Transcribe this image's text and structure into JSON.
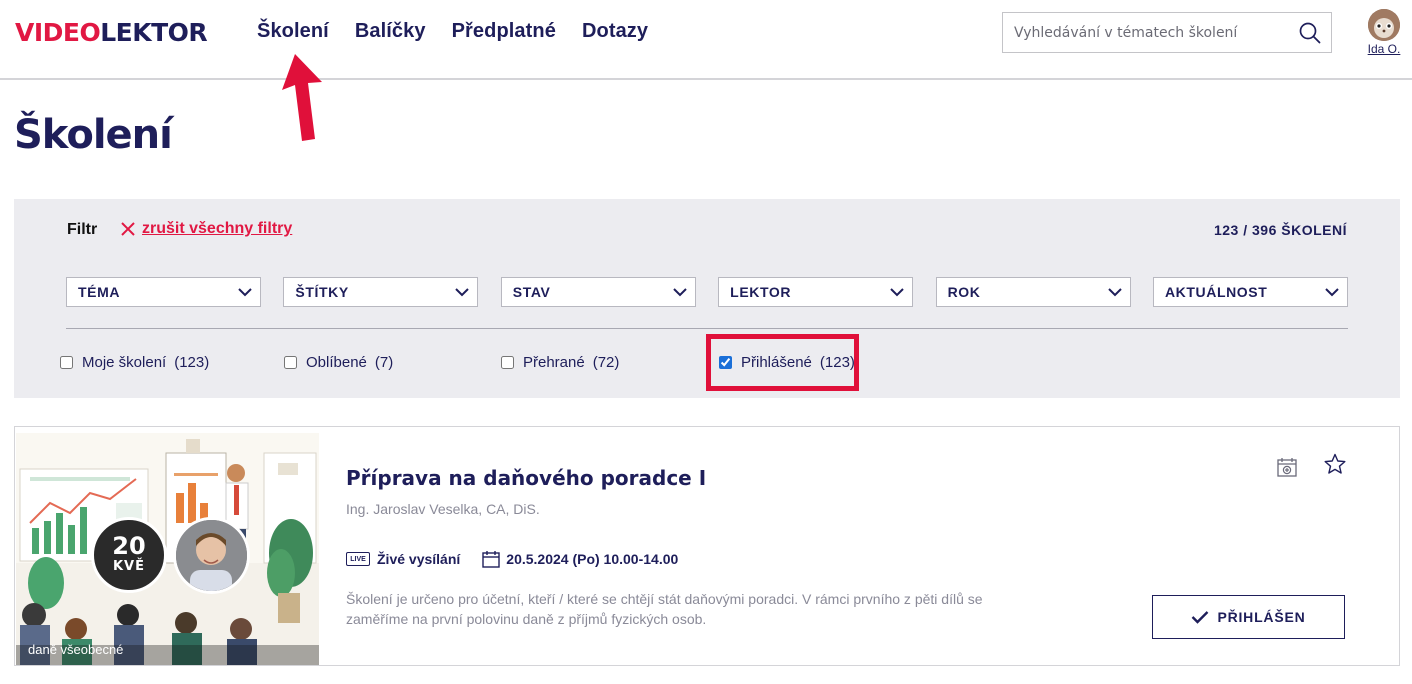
{
  "brand": {
    "logo_red": "VIDEO",
    "logo_navy": "LEKTOR",
    "accent": "#e11843",
    "navy": "#1e1e5a"
  },
  "nav": {
    "items": [
      "Školení",
      "Balíčky",
      "Předplatné",
      "Dotazy"
    ]
  },
  "search": {
    "placeholder": "Vyhledávání v tématech školení",
    "value": ""
  },
  "user": {
    "name": "Ida O."
  },
  "page": {
    "title": "Školení"
  },
  "filter": {
    "label": "Filtr",
    "clear_label": "zrušit všechny filtry",
    "count_label": "123 / 396 ŠKOLENÍ",
    "dropdowns": [
      "TÉMA",
      "ŠTÍTKY",
      "STAV",
      "LEKTOR",
      "ROK",
      "AKTUÁLNOST"
    ],
    "checkboxes": [
      {
        "label": "Moje školení",
        "count": "(123)",
        "checked": false
      },
      {
        "label": "Oblíbené",
        "count": "(7)",
        "checked": false
      },
      {
        "label": "Přehrané",
        "count": "(72)",
        "checked": false
      },
      {
        "label": "Přihlášené",
        "count": "(123)",
        "checked": true
      }
    ]
  },
  "course": {
    "title": "Příprava na daňového poradce I",
    "lector": "Ing. Jaroslav Veselka, CA, DiS.",
    "live_badge": "LIVE",
    "mode": "Živé vysílání",
    "datetime": "20.5.2024 (Po) 10.00-14.00",
    "date_day": "20",
    "date_month": "KVĚ",
    "category": "daně všeobecné",
    "description": "Školení je určeno pro účetní, kteří / které se chtějí stát daňovými poradci. V rámci prvního z pěti dílů se zaměříme na první polovinu daně z příjmů fyzických osob.",
    "status_button": "PŘIHLÁŠEN"
  }
}
